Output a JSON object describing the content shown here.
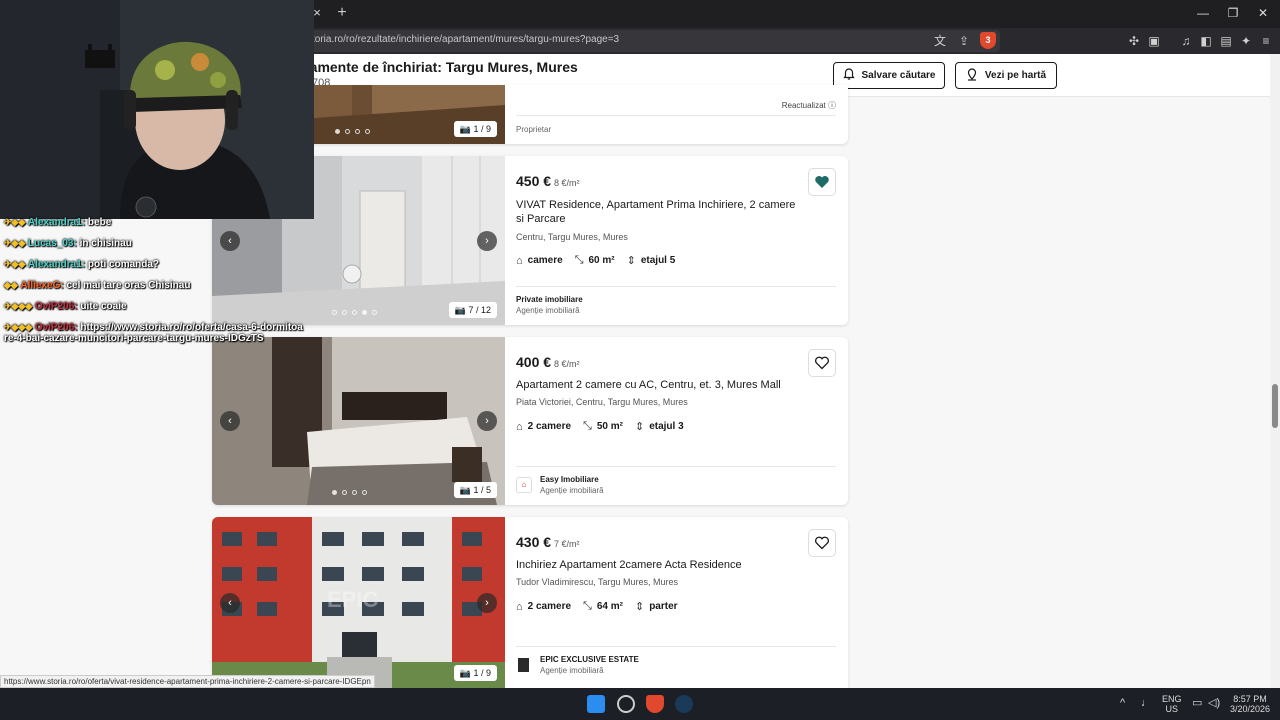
{
  "browser": {
    "url": "toria.ro/ro/rezultate/inchiriere/apartament/mures/targu-mures?page=3",
    "tab_close": "×",
    "new_tab": "+",
    "brave_badge": "3"
  },
  "header": {
    "title": "tamente de închiriat: Targu Mures, Mures",
    "count": "708",
    "save_search": "Salvare căutare",
    "view_map": "Vezi pe hartă"
  },
  "listings": [
    {
      "reactualizat": "Reactualizat",
      "owner": "Proprietar",
      "photo_counter": "1 / 9"
    },
    {
      "price": "450 €",
      "price_per_m": "8 €/m²",
      "title": "VIVAT Residence, Apartament Prima Inchiriere, 2 camere si Parcare",
      "location": "Centru, Targu Mures, Mures",
      "rooms": "camere",
      "area": "60 m²",
      "floor": "etajul 5",
      "agency": "Private imobiliare",
      "agency_type": "Agenție imobiliară",
      "photo_counter": "7 / 12",
      "favorited": true
    },
    {
      "price": "400 €",
      "price_per_m": "8 €/m²",
      "title": "Apartament 2 camere cu AC, Centru, et. 3, Mures Mall",
      "location": "Piata Victoriei, Centru, Targu Mures, Mures",
      "rooms": "2 camere",
      "area": "50 m²",
      "floor": "etajul 3",
      "agency": "Easy Imobiliare",
      "agency_type": "Agenție imobiliară",
      "photo_counter": "1 / 5",
      "favorited": false
    },
    {
      "price": "430 €",
      "price_per_m": "7 €/m²",
      "title": "Inchiriez Apartament 2camere Acta Residence",
      "location": "Tudor Vladimirescu, Targu Mures, Mures",
      "rooms": "2 camere",
      "area": "64 m²",
      "floor": "parter",
      "agency": "EPIC EXCLUSIVE ESTATE",
      "agency_type": "Agenție imobiliară",
      "photo_counter": "1 / 9",
      "favorited": false,
      "watermark": "EPIC"
    }
  ],
  "chat": [
    {
      "user": "Alexandra1:",
      "text": "bebe"
    },
    {
      "user": "Lucas_03:",
      "text": "in chisinau"
    },
    {
      "user": "Alexandra1:",
      "text": "poti comanda?"
    },
    {
      "user": "AlliexeG:",
      "text": "cel mai tare oras Chisinau"
    },
    {
      "user": "OviP206:",
      "text": "uite coaie"
    },
    {
      "user": "OviP206:",
      "text": "https://www.storia.ro/ro/oferta/casa-6-dormitoare-4-bai-cazare-muncitori-parcare-targu-mures-IDGzTS"
    }
  ],
  "status_url": "https://www.storia.ro/ro/oferta/vivat-residence-apartament-prima-inchiriere-2-camere-si-parcare-IDGEpn",
  "taskbar": {
    "lang": "ENG",
    "region": "US",
    "time": "8:57 PM",
    "date": "3/20/2026"
  },
  "colors": {
    "favorite": "#1f6b66",
    "accent": "#1a1a1a"
  }
}
